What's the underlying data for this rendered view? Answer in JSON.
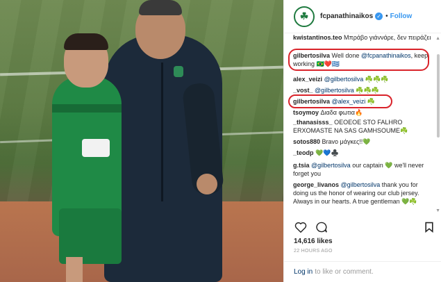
{
  "post": {
    "username": "fcpanathinaikos",
    "follow_label": "Follow",
    "dot": "•",
    "avatar_glyph": "☘",
    "likes": "14,616 likes",
    "time": "22 HOURS AGO",
    "footer": {
      "login": "Log in",
      "rest": "to like or comment."
    }
  },
  "comments": [
    {
      "user": "kwistantinos.teo",
      "text": "Μπράβο γιάννάρε, δεν πειράζει συνεχίζουμε!!",
      "mention": ""
    },
    {
      "user": "gilbertosilva",
      "pre": "Well done",
      "mention": "@fcpanathinaikos",
      "text": ", keep working 🇧🇷❤️🇬🇷"
    },
    {
      "user": "alex_veizi",
      "mention": "@gilbertosilva",
      "text": "☘️☘️☘️"
    },
    {
      "user": "_vost_",
      "mention": "@gilbertosilva",
      "text": "☘️☘️☘️"
    },
    {
      "user": "gilbertosilva",
      "mention": "@alex_veizi",
      "text": "☘️"
    },
    {
      "user": "tsoymoy",
      "text": "Διαδα φωτια🔥",
      "mention": ""
    },
    {
      "user": "_thanasisss_",
      "text": "ΟΕΟΕΟΕ STO FALHRO ERXOMASTE NA SAS GAMHSOUME☘️",
      "mention": ""
    },
    {
      "user": "sotos880",
      "text": "Bravo μάγκες!!💚",
      "mention": ""
    },
    {
      "user": "_teodp",
      "text": "💚💙♣️",
      "mention": ""
    },
    {
      "user": "g.tsia",
      "mention": "@gilbertosilva",
      "text": "our captain 💚 we'll never forget you"
    },
    {
      "user": "george_livanos",
      "mention": "@gilbertosilva",
      "text": "thank you for doing us the honor of wearing our club jersey. Always in our hearts. A true gentleman 💚☘️"
    }
  ],
  "colors": {
    "accent": "#3897f0",
    "highlight": "#d9232a",
    "mention": "#003569"
  }
}
